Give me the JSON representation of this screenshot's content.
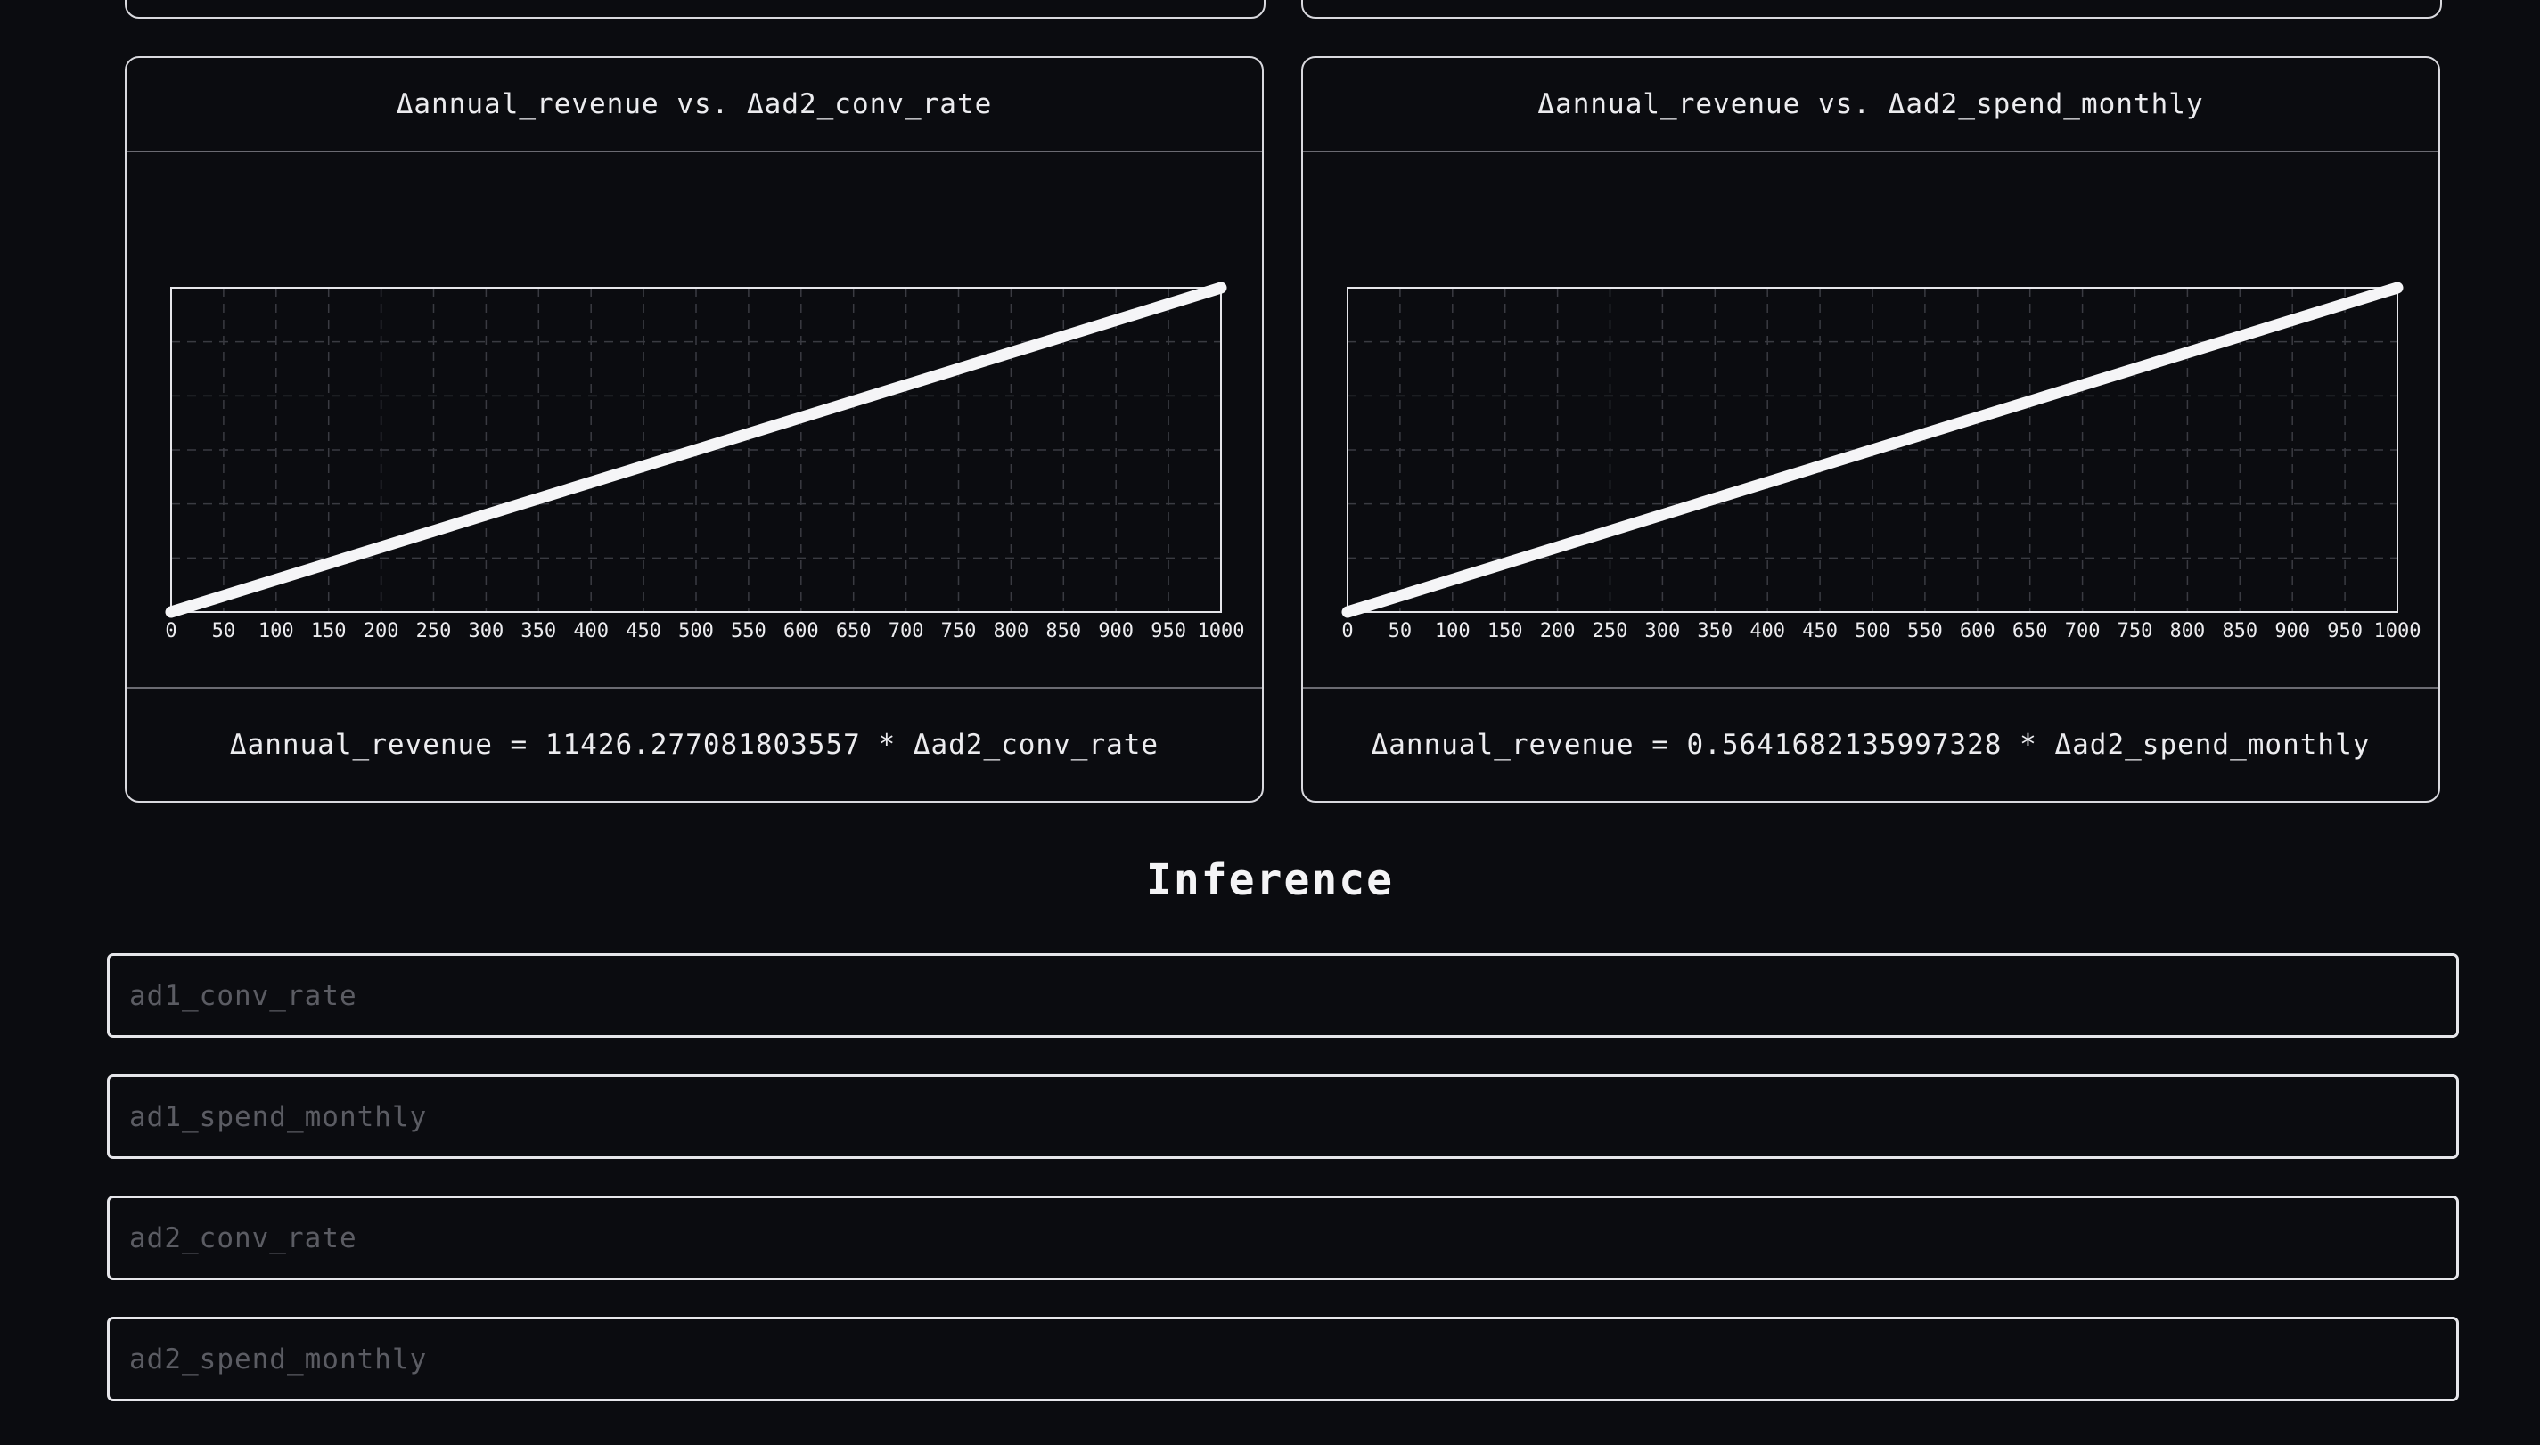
{
  "charts": [
    {
      "title": "Δannual_revenue vs. Δad2_conv_rate",
      "equation": "Δannual_revenue = 11426.277081803557 * Δad2_conv_rate",
      "chart_data": {
        "type": "line",
        "title": "Δannual_revenue vs. Δad2_conv_rate",
        "xlabel": "",
        "ylabel": "",
        "xlim": [
          0,
          1000
        ],
        "ylim": [
          0,
          11426.277081803557
        ],
        "x_ticks": [
          "0",
          "50",
          "100",
          "150",
          "200",
          "250",
          "300",
          "350",
          "400",
          "450",
          "500",
          "550",
          "600",
          "650",
          "700",
          "750",
          "800",
          "850",
          "900",
          "950",
          "1000"
        ],
        "grid": true,
        "series": [
          {
            "x": [
              0,
              1000
            ],
            "y": [
              0,
              11426.277081803557
            ]
          }
        ]
      }
    },
    {
      "title": "Δannual_revenue vs. Δad2_spend_monthly",
      "equation": "Δannual_revenue = 0.5641682135997328 * Δad2_spend_monthly",
      "chart_data": {
        "type": "line",
        "title": "Δannual_revenue vs. Δad2_spend_monthly",
        "xlabel": "",
        "ylabel": "",
        "xlim": [
          0,
          1000
        ],
        "ylim": [
          0,
          564.1682135997328
        ],
        "x_ticks": [
          "0",
          "50",
          "100",
          "150",
          "200",
          "250",
          "300",
          "350",
          "400",
          "450",
          "500",
          "550",
          "600",
          "650",
          "700",
          "750",
          "800",
          "850",
          "900",
          "950",
          "1000"
        ],
        "grid": true,
        "series": [
          {
            "x": [
              0,
              1000
            ],
            "y": [
              0,
              564.1682135997328
            ]
          }
        ]
      }
    }
  ],
  "inference": {
    "title": "Inference",
    "fields": [
      {
        "placeholder": "ad1_conv_rate"
      },
      {
        "placeholder": "ad1_spend_monthly"
      },
      {
        "placeholder": "ad2_conv_rate"
      },
      {
        "placeholder": "ad2_spend_monthly"
      }
    ]
  }
}
